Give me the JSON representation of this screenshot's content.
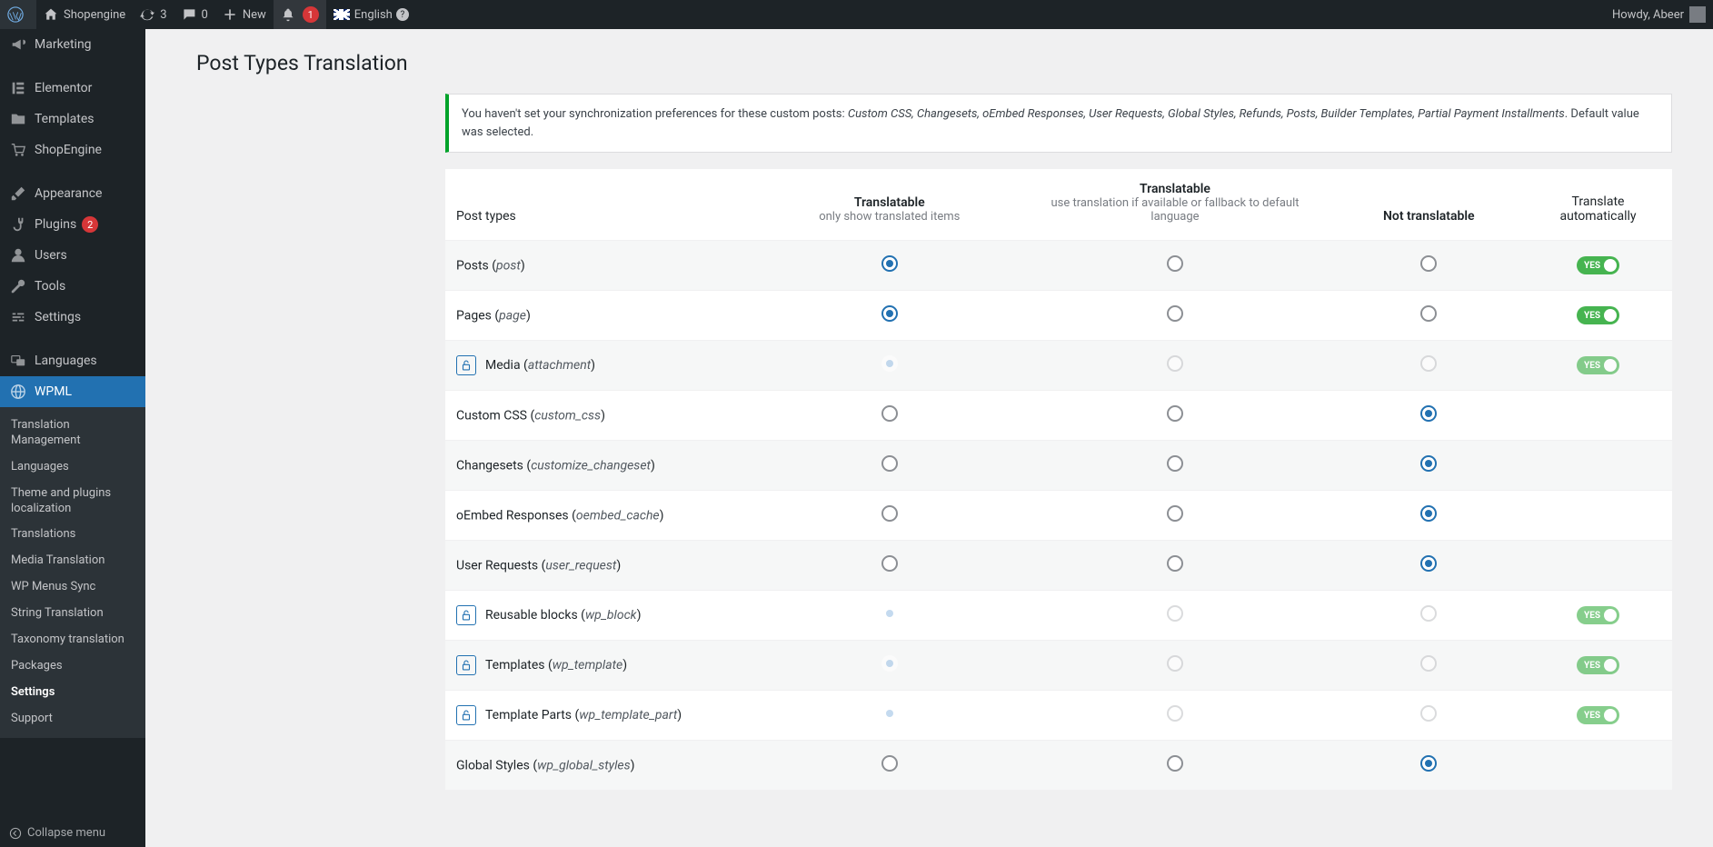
{
  "adminbar": {
    "site_name": "Shopengine",
    "updates_count": "3",
    "comments_count": "0",
    "new_label": "New",
    "notif_count": "1",
    "language": "English",
    "howdy": "Howdy, Abeer"
  },
  "sidebar": {
    "items": [
      {
        "label": "Marketing",
        "icon": "megaphone"
      },
      {
        "label": "Elementor",
        "icon": "elementor"
      },
      {
        "label": "Templates",
        "icon": "folder"
      },
      {
        "label": "ShopEngine",
        "icon": "cart"
      },
      {
        "label": "Appearance",
        "icon": "brush"
      },
      {
        "label": "Plugins",
        "icon": "plug",
        "badge": "2"
      },
      {
        "label": "Users",
        "icon": "user"
      },
      {
        "label": "Tools",
        "icon": "wrench"
      },
      {
        "label": "Settings",
        "icon": "sliders"
      },
      {
        "label": "Languages",
        "icon": "lang"
      },
      {
        "label": "WPML",
        "icon": "globe",
        "current": true
      }
    ],
    "submenu": [
      "Translation Management",
      "Languages",
      "Theme and plugins localization",
      "Translations",
      "Media Translation",
      "WP Menus Sync",
      "String Translation",
      "Taxonomy translation",
      "Packages",
      "Settings",
      "Support"
    ],
    "submenu_current": "Settings",
    "collapse": "Collapse menu"
  },
  "page": {
    "title": "Post Types Translation",
    "notice_pre": "You haven't set your synchronization preferences for these custom posts: ",
    "notice_list": "Custom CSS, Changesets, oEmbed Responses, User Requests, Global Styles, Refunds, Posts, Builder Templates, Partial Payment Installments",
    "notice_post": ". Default value was selected."
  },
  "table": {
    "headers": {
      "post_types": "Post types",
      "col1_l1": "Translatable",
      "col1_l2": "only show translated items",
      "col2_l1": "Translatable",
      "col2_l2": "use translation if available or fallback to default language",
      "col3": "Not translatable",
      "col4_l1": "Translate",
      "col4_l2": "automatically"
    },
    "toggle_on": "YES",
    "rows": [
      {
        "name": "Posts",
        "slug": "post",
        "sel": 0,
        "toggle": true,
        "locked": false,
        "stripe": true
      },
      {
        "name": "Pages",
        "slug": "page",
        "sel": 0,
        "toggle": true,
        "locked": false,
        "stripe": false
      },
      {
        "name": "Media",
        "slug": "attachment",
        "sel": 0,
        "toggle": true,
        "locked": true,
        "stripe": true
      },
      {
        "name": "Custom CSS",
        "slug": "custom_css",
        "sel": 2,
        "toggle": false,
        "locked": false,
        "stripe": false
      },
      {
        "name": "Changesets",
        "slug": "customize_changeset",
        "sel": 2,
        "toggle": false,
        "locked": false,
        "stripe": true
      },
      {
        "name": "oEmbed Responses",
        "slug": "oembed_cache",
        "sel": 2,
        "toggle": false,
        "locked": false,
        "stripe": false
      },
      {
        "name": "User Requests",
        "slug": "user_request",
        "sel": 2,
        "toggle": false,
        "locked": false,
        "stripe": true
      },
      {
        "name": "Reusable blocks",
        "slug": "wp_block",
        "sel": 0,
        "toggle": true,
        "locked": true,
        "stripe": false
      },
      {
        "name": "Templates",
        "slug": "wp_template",
        "sel": 0,
        "toggle": true,
        "locked": true,
        "stripe": true
      },
      {
        "name": "Template Parts",
        "slug": "wp_template_part",
        "sel": 0,
        "toggle": true,
        "locked": true,
        "stripe": false
      },
      {
        "name": "Global Styles",
        "slug": "wp_global_styles",
        "sel": 2,
        "toggle": false,
        "locked": false,
        "stripe": true
      }
    ]
  }
}
